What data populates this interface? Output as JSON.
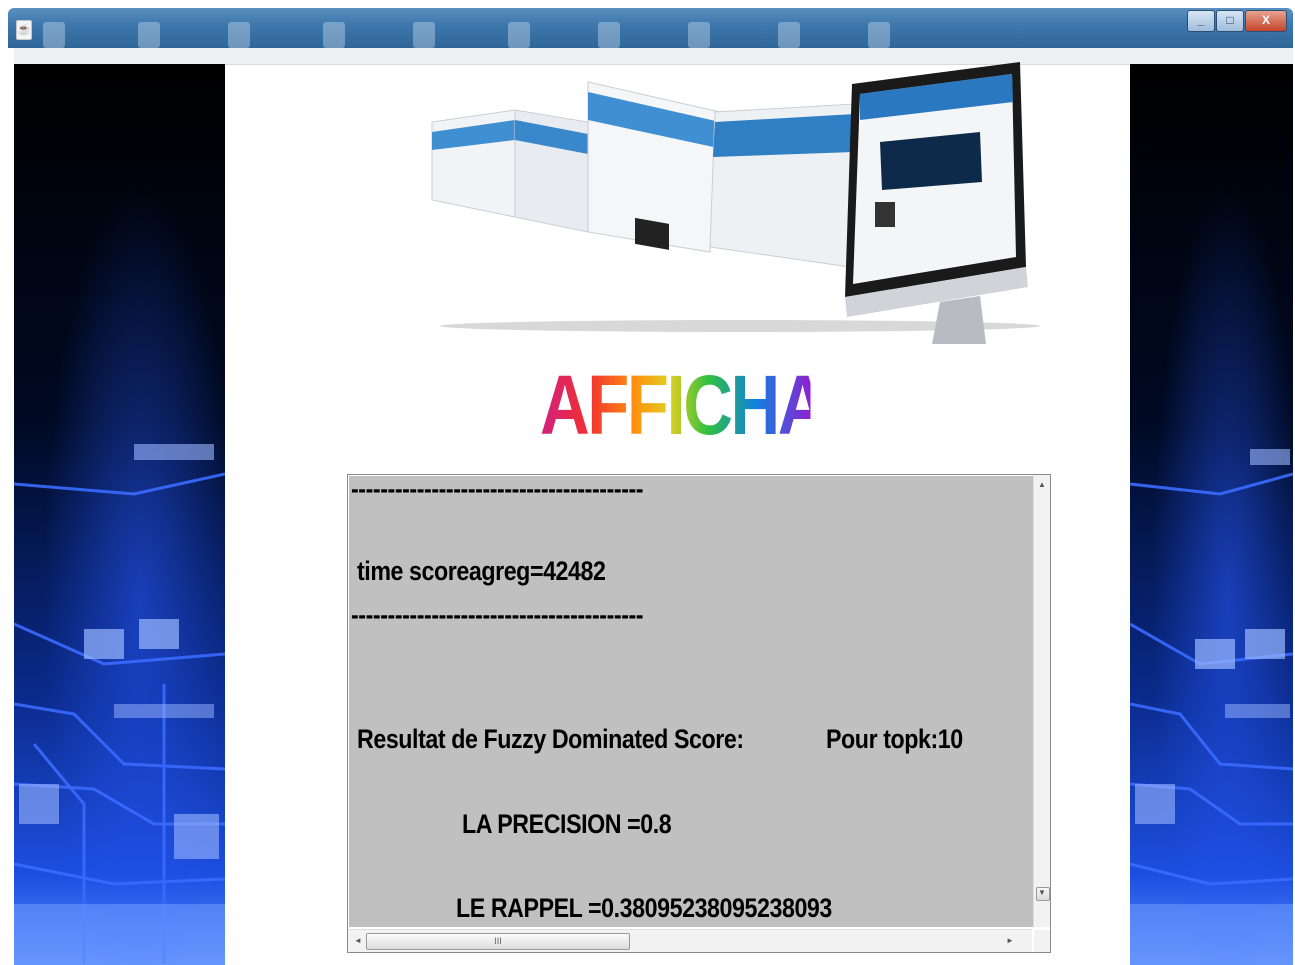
{
  "window": {
    "controls": {
      "minimize": "_",
      "maximize": "□",
      "close": "X"
    }
  },
  "logo": {
    "text": "AFFICHAGE"
  },
  "results": {
    "lines": [
      "----------------------------------------",
      "time scoreagreg=42482",
      "----------------------------------------",
      "Resultat de Fuzzy Dominated Score:",
      "Pour topk:10",
      "LA PRECISION =0.8",
      "LE RAPPEL =0.38095238095238093"
    ]
  },
  "scrollbars": {
    "up_arrow": "▲",
    "down_arrow": "▼",
    "left_arrow": "◄",
    "right_arrow": "►",
    "grip": "III"
  },
  "colors": {
    "textarea_bg": "#c0c0c0",
    "titlebar": "#3f78ad",
    "circuit_blue": "#1d4ee0"
  }
}
